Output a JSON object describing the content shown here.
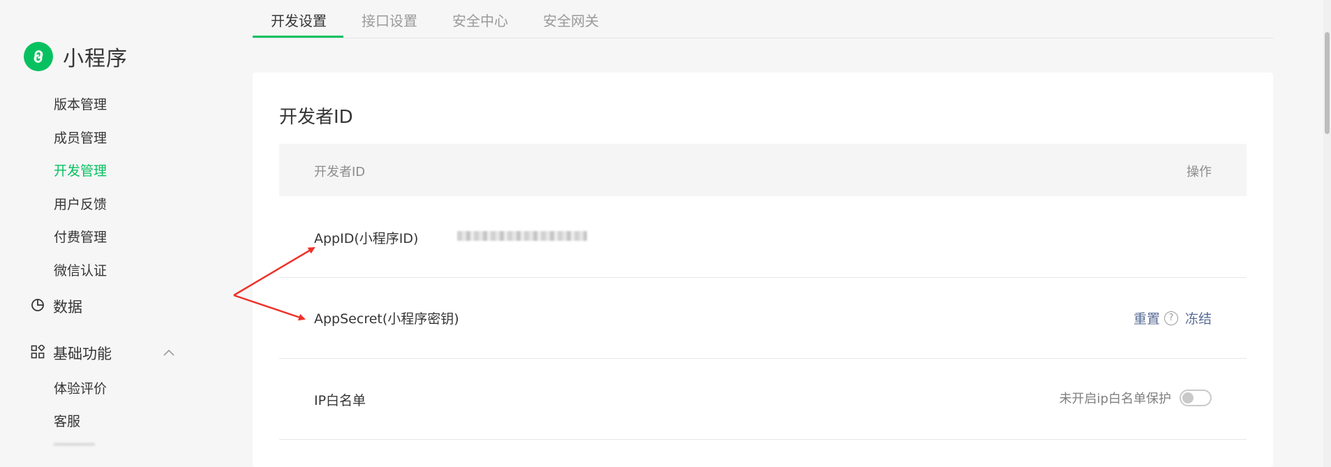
{
  "brand": {
    "name": "小程序",
    "icon": "mini-program-logo",
    "color": "#07c160"
  },
  "sidebar": {
    "dev_sub_items": [
      {
        "label": "版本管理",
        "active": false
      },
      {
        "label": "成员管理",
        "active": false
      },
      {
        "label": "开发管理",
        "active": true
      },
      {
        "label": "用户反馈",
        "active": false
      },
      {
        "label": "付费管理",
        "active": false
      },
      {
        "label": "微信认证",
        "active": false
      }
    ],
    "data_group": {
      "label": "数据",
      "icon": "pie-chart-icon"
    },
    "basic_group": {
      "label": "基础功能",
      "icon": "grid-apps-icon",
      "expanded": true,
      "items": [
        {
          "label": "体验评价"
        },
        {
          "label": "客服"
        }
      ]
    }
  },
  "tabs": [
    {
      "label": "开发设置",
      "active": true
    },
    {
      "label": "接口设置",
      "active": false
    },
    {
      "label": "安全中心",
      "active": false
    },
    {
      "label": "安全网关",
      "active": false
    }
  ],
  "card": {
    "title": "开发者ID",
    "columns": {
      "name": "开发者ID",
      "action": "操作"
    },
    "rows": {
      "appid": {
        "label": "AppID(小程序ID)",
        "value_masked": true
      },
      "appsecret": {
        "label": "AppSecret(小程序密钥)",
        "reset": "重置",
        "help_icon": "question-circle-icon",
        "freeze": "冻结"
      },
      "ip_whitelist": {
        "label": "IP白名单",
        "status": "未开启ip白名单保护",
        "toggle_on": false
      }
    }
  },
  "colors": {
    "accent": "#07c160",
    "link": "#576b95",
    "annotation_arrow": "#f0312a"
  }
}
